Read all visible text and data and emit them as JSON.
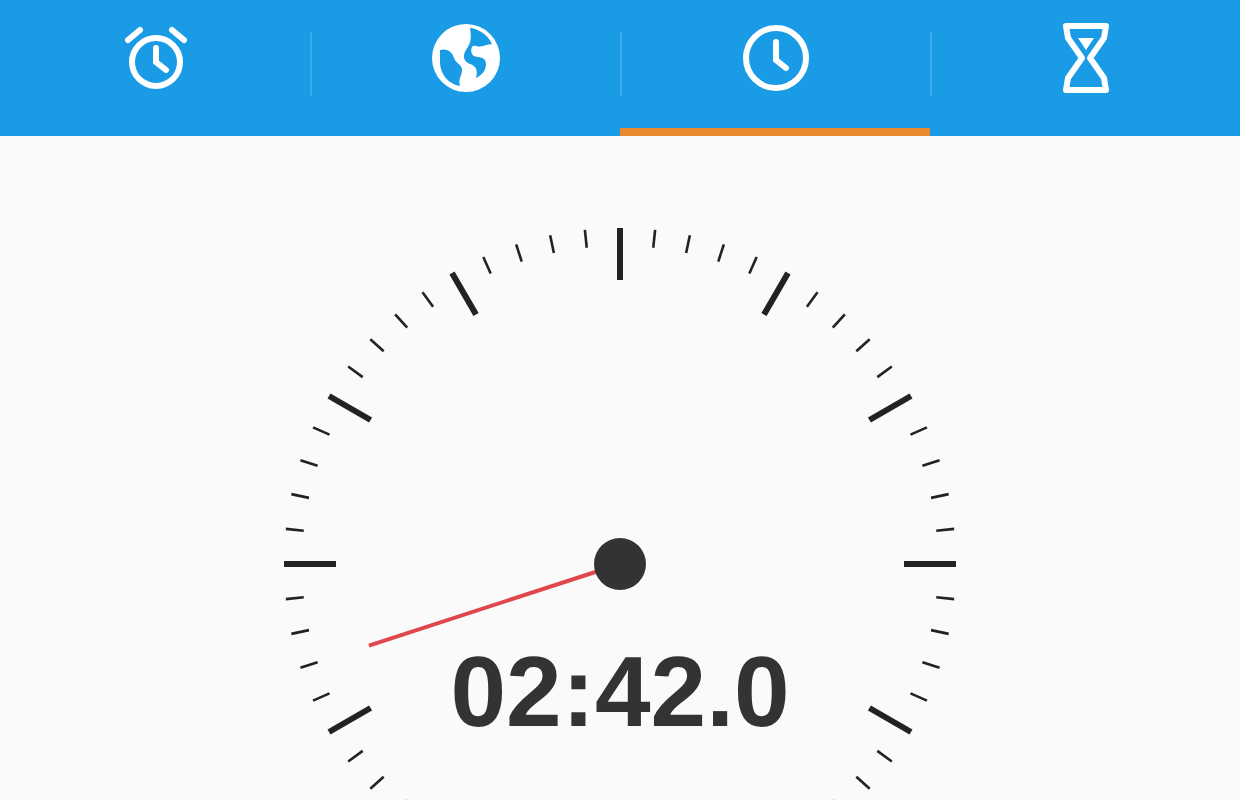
{
  "tabs": [
    {
      "kind": "alarm",
      "selected": false
    },
    {
      "kind": "world",
      "selected": false
    },
    {
      "kind": "stopwatch",
      "selected": true
    },
    {
      "kind": "timer",
      "selected": false
    }
  ],
  "stopwatch": {
    "time": "02:42.0"
  }
}
